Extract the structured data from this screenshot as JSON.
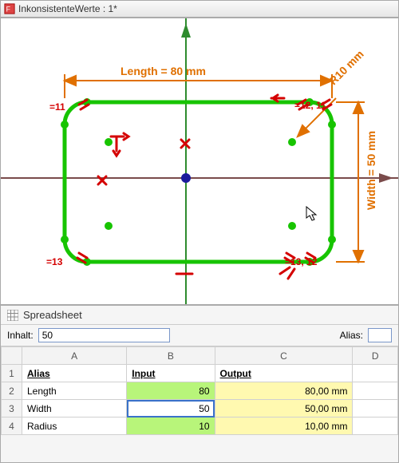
{
  "window": {
    "title": "InkonsistenteWerte : 1*"
  },
  "sketch": {
    "dims": {
      "length_label": "Length = 80 mm",
      "width_label": "Width = 50 mm",
      "radius_label": "R10 mm"
    },
    "constraints": {
      "c11": "11",
      "c12": "12",
      "c13": "13",
      "c12_11": "12, 11",
      "c13_12": "13, 12"
    }
  },
  "spreadsheet": {
    "panel_title": "Spreadsheet",
    "content_label": "Inhalt:",
    "content_value": "50",
    "alias_label": "Alias:",
    "columns": [
      "A",
      "B",
      "C",
      "D"
    ],
    "headers": {
      "alias": "Alias",
      "input": "Input",
      "output": "Output"
    },
    "rows": [
      {
        "n": "1"
      },
      {
        "n": "2",
        "alias": "Length",
        "input": "80",
        "output": "80,00 mm",
        "hl": true
      },
      {
        "n": "3",
        "alias": "Width",
        "input": "50",
        "output": "50,00 mm",
        "hl": false,
        "selected": true
      },
      {
        "n": "4",
        "alias": "Radius",
        "input": "10",
        "output": "10,00 mm",
        "hl": true
      }
    ]
  },
  "colors": {
    "dim": "#e07000",
    "constraint": "#d40000",
    "geom": "#17c400",
    "axis_v": "#2e8b2e",
    "axis_h": "#7a4b4b"
  }
}
